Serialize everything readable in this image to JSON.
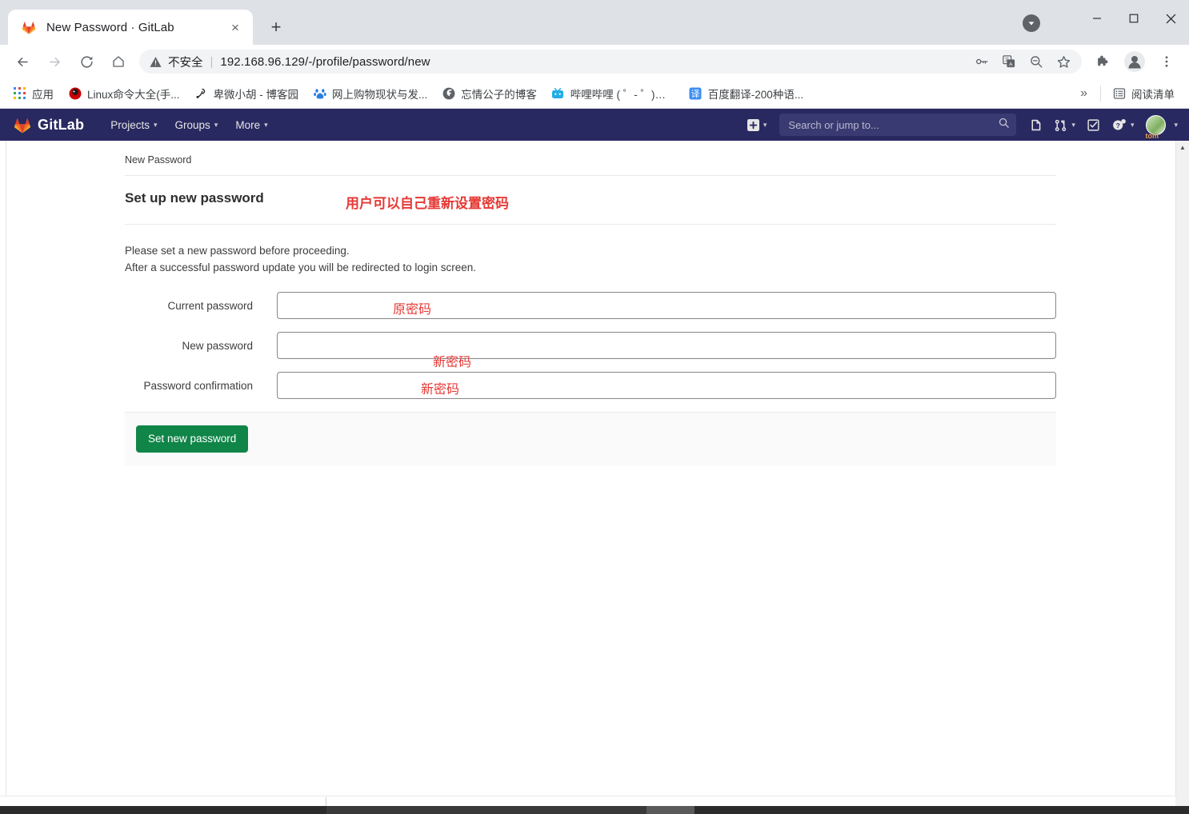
{
  "window": {
    "minimize_label": "Minimize",
    "maximize_label": "Maximize",
    "close_label": "Close",
    "download_indicator": "download-icon"
  },
  "tab": {
    "title": "New Password · GitLab",
    "favicon": "gitlab-fox-icon",
    "close_label": "×",
    "new_tab_label": "+"
  },
  "toolbar": {
    "back_label": "back-arrow",
    "forward_label": "forward-arrow",
    "reload_label": "reload",
    "home_label": "home",
    "security_text": "不安全",
    "separator": "|",
    "url": "192.168.96.129/-/profile/password/new",
    "right_icons": [
      "key-icon",
      "translate-icon",
      "zoom-out-icon",
      "star-icon",
      "extensions-icon",
      "profile-icon",
      "more-menu-icon"
    ]
  },
  "bookmarks": {
    "items": [
      {
        "label": "应用",
        "icon": "apps-grid-icon"
      },
      {
        "label": "Linux命令大全(手...",
        "icon": "red-circle-icon"
      },
      {
        "label": "卑微小胡 - 博客园",
        "icon": "cnblogs-icon"
      },
      {
        "label": "网上购物现状与发...",
        "icon": "baidu-icon"
      },
      {
        "label": "忘情公子的博客",
        "icon": "globe-icon"
      },
      {
        "label": "哔哩哔哩 ( ゜- ゜)つ...",
        "icon": "bilibili-icon"
      },
      {
        "label": "百度翻译-200种语...",
        "icon": "translate-badge-icon"
      }
    ],
    "overflow_label": "»",
    "reading_list_label": "阅读清单",
    "reading_list_icon": "reading-list-icon"
  },
  "gitlab_nav": {
    "brand": "GitLab",
    "brand_icon": "gitlab-fox-icon",
    "menu": [
      {
        "label": "Projects"
      },
      {
        "label": "Groups"
      },
      {
        "label": "More"
      }
    ],
    "caret": "▾",
    "plus_icon": "plus-square-icon",
    "search_placeholder": "Search or jump to...",
    "search_value": "",
    "search_icon": "search-icon",
    "issues_icon": "issues-icon",
    "merge_requests_icon": "merge-request-icon",
    "todos_icon": "todos-icon",
    "help_icon": "help-question-icon",
    "avatar_icon": "user-avatar",
    "avatar_name": "tom"
  },
  "page": {
    "breadcrumb": "New Password",
    "section_title": "Set up new password",
    "annotation_title": "用户可以自己重新设置密码",
    "intro_line1": "Please set a new password before proceeding.",
    "intro_line2": "After a successful password update you will be redirected to login screen.",
    "fields": [
      {
        "label": "Current password",
        "value": "",
        "annotation": "原密码",
        "name": "current-password"
      },
      {
        "label": "New password",
        "value": "",
        "annotation": "新密码",
        "name": "new-password"
      },
      {
        "label": "Password confirmation",
        "value": "",
        "annotation": "新密码",
        "name": "password-confirmation"
      }
    ],
    "submit_label": "Set new password"
  },
  "colors": {
    "gitlab_navbar": "#292961",
    "primary_button": "#108548",
    "annotation_red": "#e53935",
    "chrome_titlebar": "#dee1e6"
  }
}
